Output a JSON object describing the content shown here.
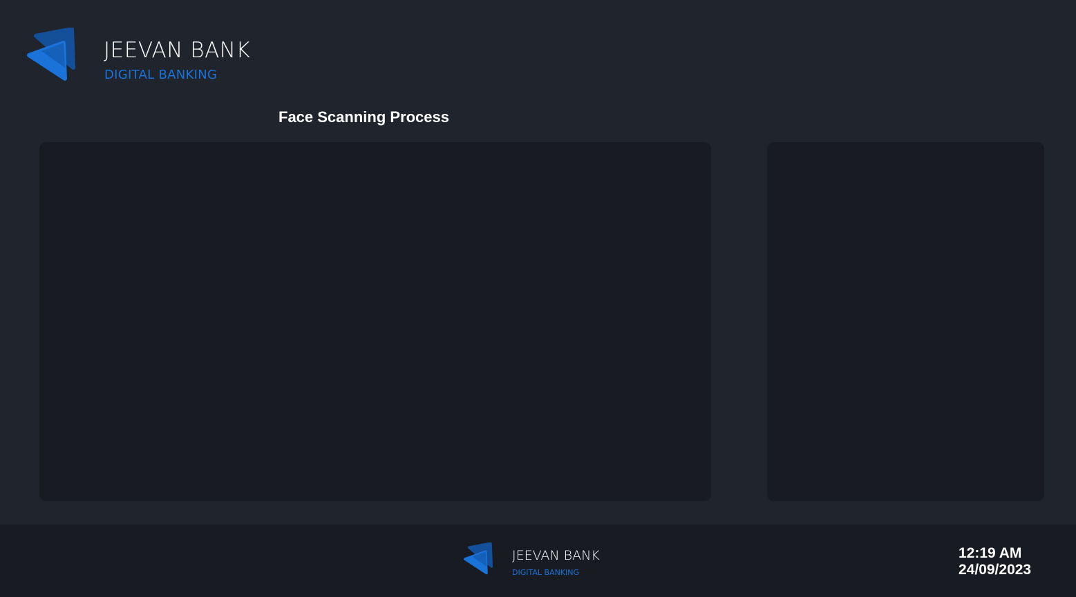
{
  "header": {
    "logo_icon": "play-triangles-logo-icon",
    "brand_name": "JEEVAN BANK",
    "brand_subtitle": "DIGITAL BANKING"
  },
  "main": {
    "title": "Face Scanning Process"
  },
  "footer": {
    "logo_icon": "play-triangles-logo-icon",
    "brand_name": "JEEVAN BANK",
    "brand_subtitle": "DIGITAL BANKING",
    "time": "12:19 AM",
    "date": "24/09/2023"
  },
  "colors": {
    "background": "#1f242d",
    "panel": "#181b22",
    "footer": "#181b22",
    "accent_blue": "#1a73d9",
    "accent_dark_blue": "#14509a",
    "text": "#ffffff"
  }
}
